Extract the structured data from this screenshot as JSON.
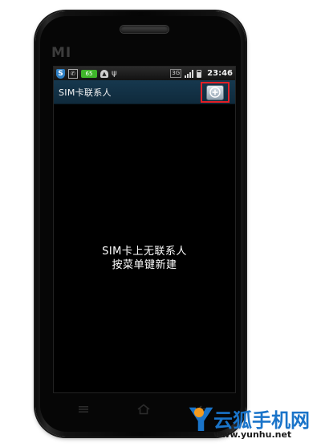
{
  "device": {
    "brand": "MI"
  },
  "statusbar": {
    "shield_icon": "shield-icon",
    "badge_text": "65",
    "network_label": "3G",
    "time": "23:46"
  },
  "titlebar": {
    "title": "SIM卡联系人",
    "add_icon": "add-circle-icon"
  },
  "empty_state": {
    "line1": "SIM卡上无联系人",
    "line2": "按菜单键新建"
  },
  "softkeys": {
    "menu_icon": "menu-icon",
    "home_icon": "home-icon",
    "back_icon": "back-icon"
  },
  "watermark": {
    "letter": "Y",
    "name": "云狐手机网",
    "url": "www.yunhu.net"
  },
  "colors": {
    "titlebar_bg": "#16384e",
    "highlight_border": "#e21f26",
    "watermark_blue": "#1a74c9"
  }
}
